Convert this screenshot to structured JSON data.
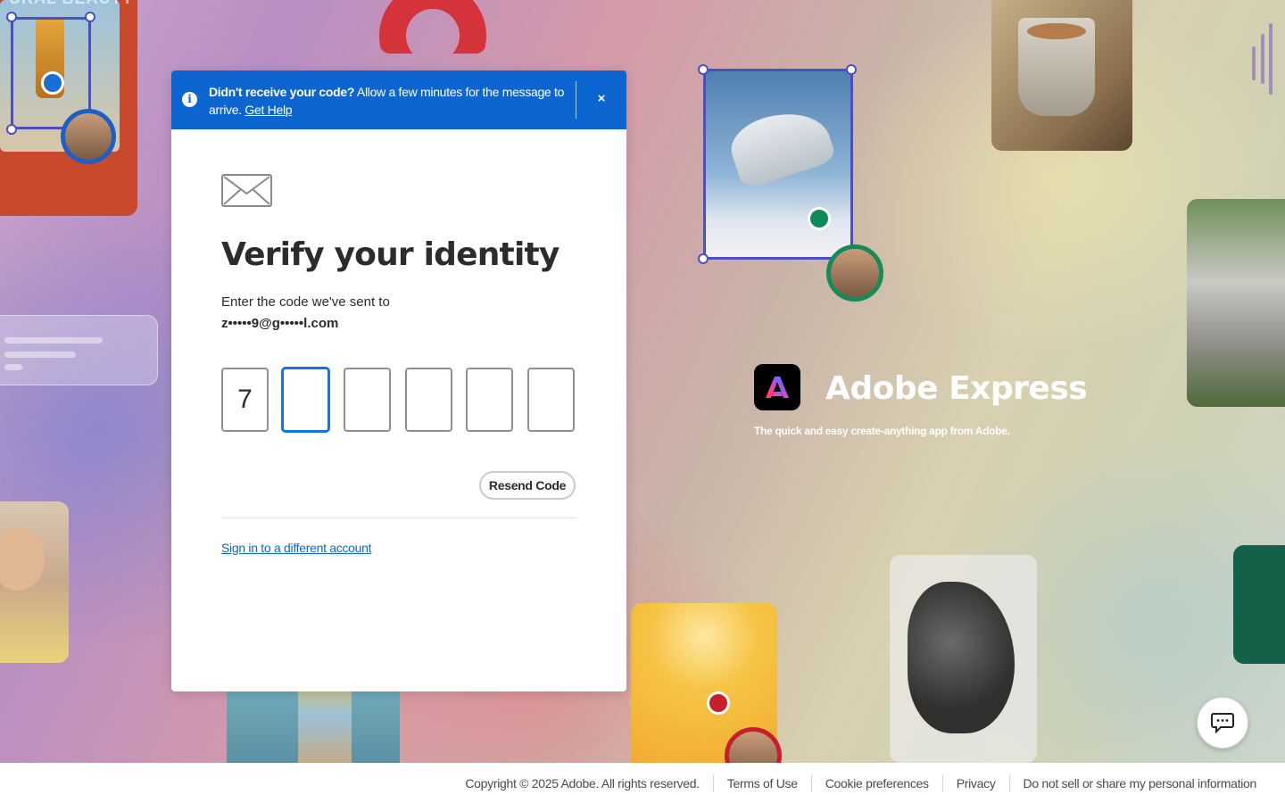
{
  "banner": {
    "bold_text": "Didn't receive your code?",
    "text": " Allow a few minutes for the message to arrive.",
    "link": "Get Help",
    "close": "×"
  },
  "dialog": {
    "title": "Verify your identity",
    "instruction": "Enter the code we've sent to",
    "email": "z•••••9@g•••••l.com",
    "code_digits": [
      "7",
      "",
      "",
      "",
      "",
      ""
    ],
    "resend_label": "Resend Code",
    "switch_account_link": "Sign in to a different account"
  },
  "brand": {
    "name": "Adobe Express",
    "tagline": "The quick and easy create-anything app from Adobe."
  },
  "background": {
    "card_headline": "URAL BEAUTY"
  },
  "footer": {
    "copyright": "Copyright © 2025 Adobe. All rights reserved.",
    "links": [
      "Terms of Use",
      "Cookie preferences",
      "Privacy",
      "Do not sell or share my personal information"
    ]
  },
  "colors": {
    "banner_blue": "#0d66d0",
    "focus_blue": "#1473e6",
    "link_blue": "#0d66d0"
  },
  "icons": {
    "banner": "info-icon",
    "close": "close-icon",
    "mail": "envelope-icon",
    "chat": "chat-icon",
    "brand": "adobe-express-logo"
  }
}
